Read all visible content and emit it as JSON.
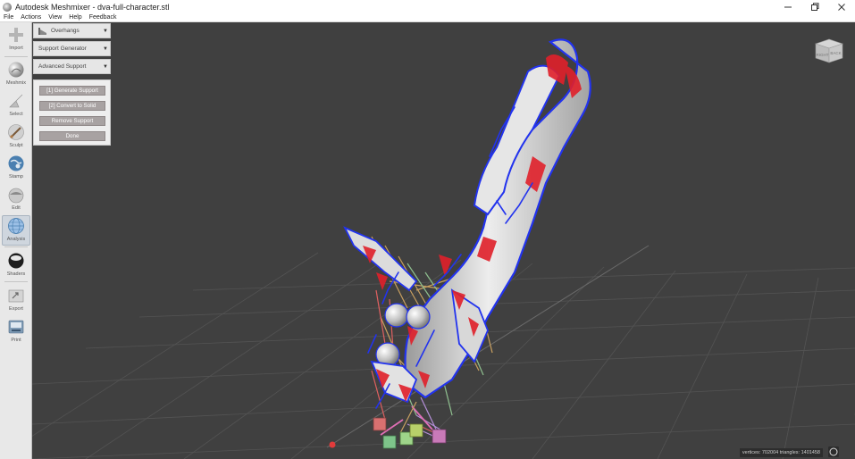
{
  "window": {
    "title": "Autodesk Meshmixer - dva-full-character.stl",
    "controls": [
      "minimize",
      "restore",
      "close"
    ]
  },
  "menu": [
    "File",
    "Actions",
    "View",
    "Help",
    "Feedback"
  ],
  "toolbar": {
    "items": [
      {
        "label": "Import",
        "icon": "plus-icon"
      },
      {
        "label": "Meshmix",
        "icon": "sphere-icon"
      },
      {
        "label": "Select",
        "icon": "arrow-icon"
      },
      {
        "label": "Sculpt",
        "icon": "brush-icon"
      },
      {
        "label": "Stamp",
        "icon": "globe-icon"
      },
      {
        "label": "Edit",
        "icon": "edit-sphere-icon"
      },
      {
        "label": "Analysis",
        "icon": "mesh-sphere-icon",
        "active": true
      },
      {
        "label": "Shaders",
        "icon": "shader-sphere-icon"
      },
      {
        "label": "Export",
        "icon": "export-icon"
      },
      {
        "label": "Print",
        "icon": "printer-icon"
      }
    ]
  },
  "panel": {
    "dropdowns": [
      {
        "label": "Overhangs"
      },
      {
        "label": "Support Generator"
      },
      {
        "label": "Advanced Support"
      }
    ],
    "buttons": [
      {
        "label": "[1] Generate Support"
      },
      {
        "label": "[2] Convert to Solid"
      },
      {
        "label": "Remove Support"
      },
      {
        "label": "Done"
      }
    ]
  },
  "viewcube": {
    "left": "RIGHT",
    "right": "BACK"
  },
  "status": {
    "text": "vertices: 702004  triangles: 1401458"
  },
  "colors": {
    "background": "#404040",
    "overhang": "#e0202a",
    "edge": "#2233ee",
    "model": "#d6d6d6",
    "button": "#a8a2a2"
  }
}
